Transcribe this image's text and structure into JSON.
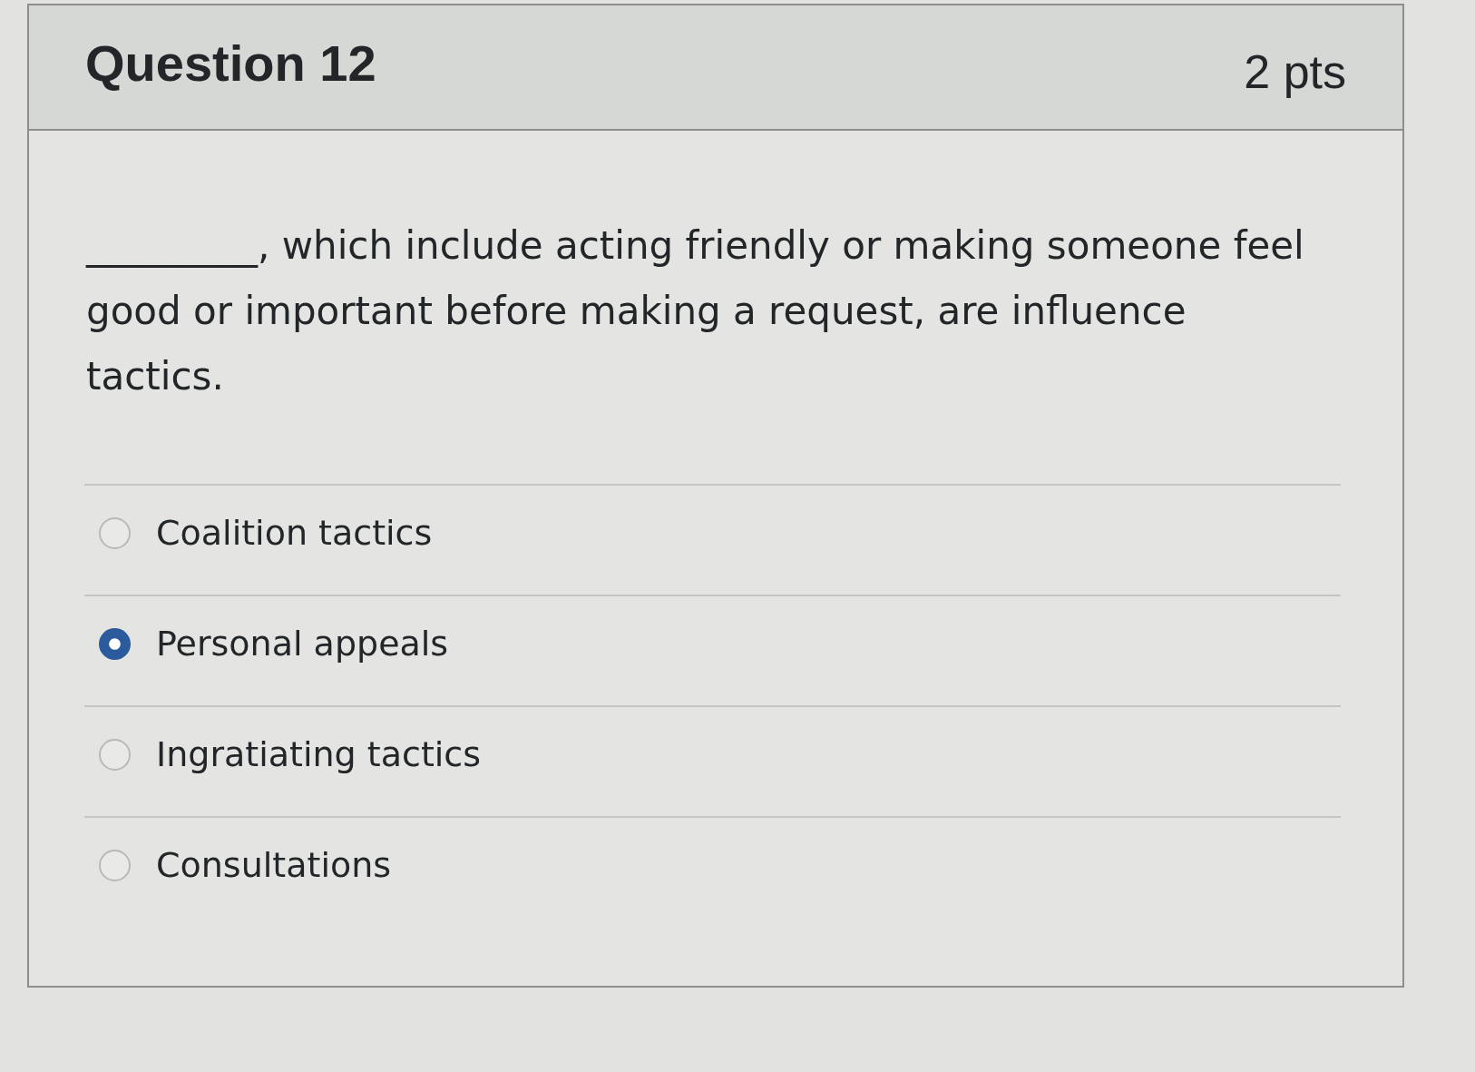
{
  "question": {
    "title": "Question 12",
    "points": "2 pts"
  },
  "prompt": "_________, which include acting friendly or making someone feel good or important before making a request, are influence tactics.",
  "answers": [
    {
      "label": "Coalition tactics",
      "selected": false
    },
    {
      "label": "Personal appeals",
      "selected": true
    },
    {
      "label": "Ingratiating tactics",
      "selected": false
    },
    {
      "label": "Consultations",
      "selected": false
    }
  ]
}
